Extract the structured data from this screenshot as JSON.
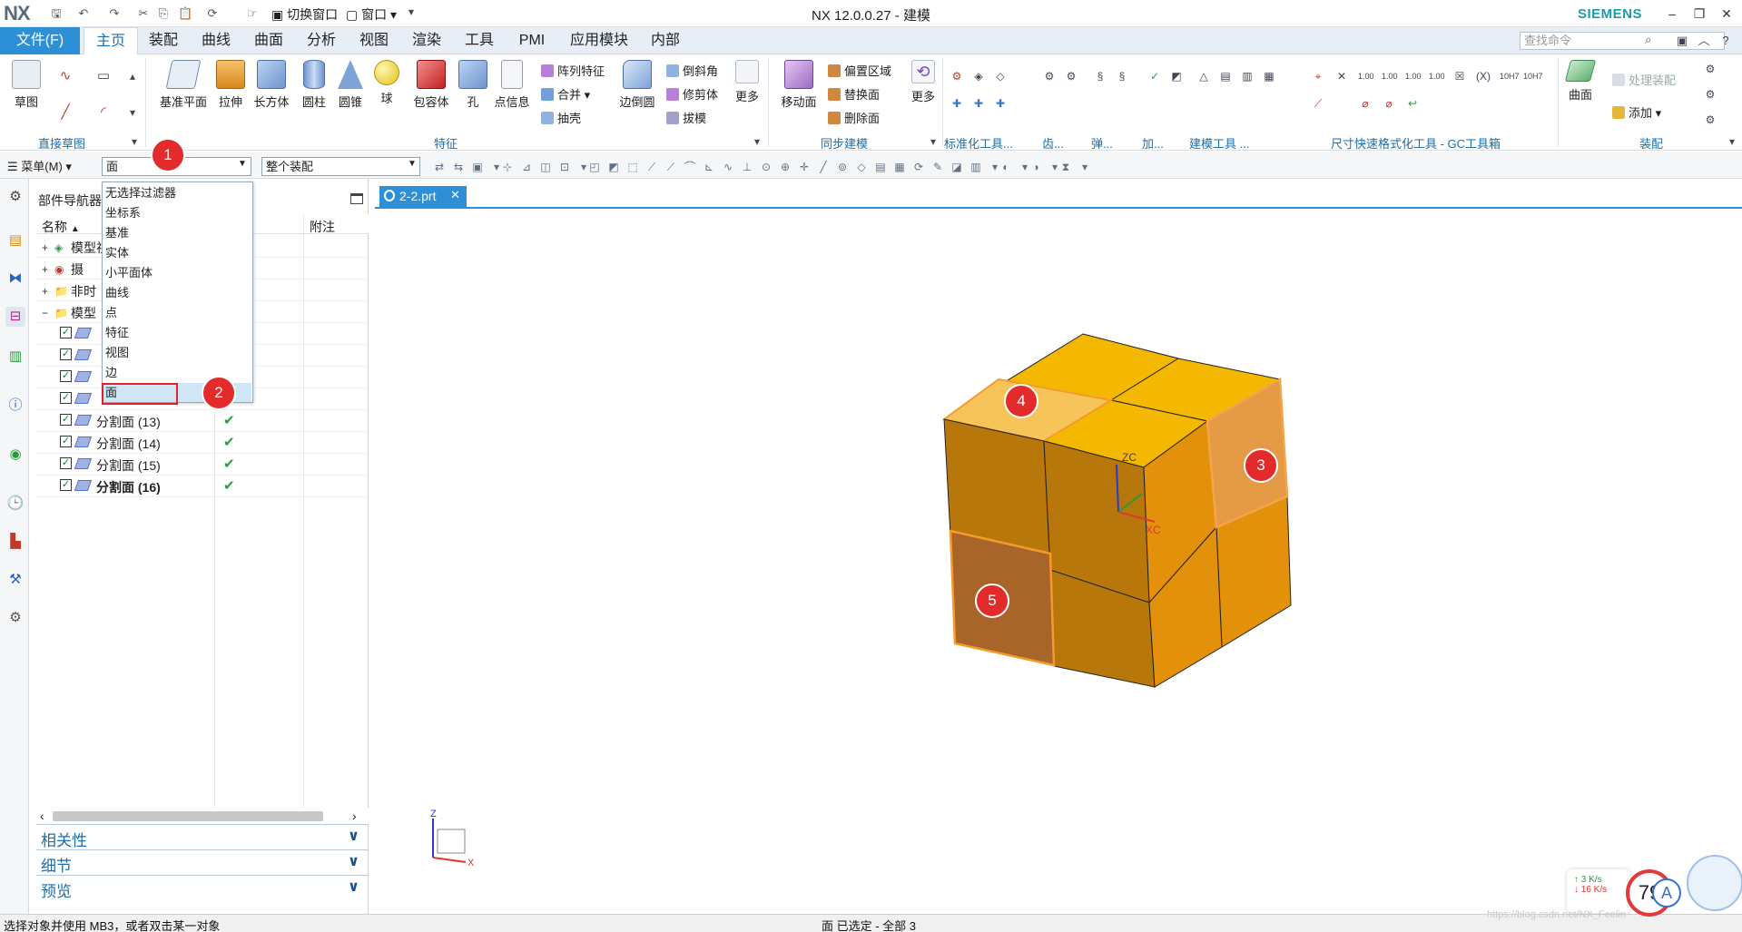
{
  "titlebar": {
    "logo": "NX",
    "title": "NX 12.0.0.27 - 建模",
    "brand": "SIEMENS",
    "switch_window": "切换窗口",
    "window_menu": "窗口",
    "min": "–",
    "restore": "❐",
    "close": "✕"
  },
  "tabs": {
    "file": "文件(F)",
    "items": [
      "主页",
      "装配",
      "曲线",
      "曲面",
      "分析",
      "视图",
      "渲染",
      "工具",
      "PMI",
      "应用模块",
      "内部"
    ],
    "active": "主页",
    "search_placeholder": "查找命令"
  },
  "ribbon": {
    "sketch": "草图",
    "direct_sketch_group": "直接草图",
    "datum_plane": "基准平面",
    "extrude": "拉伸",
    "block": "长方体",
    "cylinder": "圆柱",
    "cone": "圆锥",
    "sphere": "球",
    "bounding_body": "包容体",
    "hole": "孔",
    "point_info": "点信息",
    "pattern_feature": "阵列特征",
    "unite": "合并",
    "shell": "抽壳",
    "edge_blend": "边倒圆",
    "chamfer": "倒斜角",
    "trim_body": "修剪体",
    "draft": "拔模",
    "more1": "更多",
    "feature_group": "特征",
    "move_face": "移动面",
    "offset_region": "偏置区域",
    "replace_face": "替换面",
    "delete_face": "删除面",
    "more2": "更多",
    "sync_group": "同步建模",
    "std_tools": "标准化工具...",
    "gear": "齿...",
    "spring": "弹...",
    "add": "加...",
    "model_tools": "建模工具 ...",
    "dim_tools": "尺寸快速格式化工具 - GC工具箱",
    "surface": "曲面",
    "process_assembly": "处理装配",
    "add_component": "添加",
    "assembly_group": "装配"
  },
  "selection_bar": {
    "menu": "菜单(M)",
    "filter_value": "面",
    "scope_value": "整个装配"
  },
  "filter_dropdown": {
    "options": [
      "无选择过滤器",
      "坐标系",
      "基准",
      "实体",
      "小平面体",
      "曲线",
      "点",
      "特征",
      "视图",
      "边",
      "面"
    ],
    "selected": "面"
  },
  "navigator": {
    "title": "部件导航器",
    "col_name": "名称",
    "col_note": "附注",
    "rows": [
      {
        "label": "模型视",
        "expand": "+",
        "kind": "views"
      },
      {
        "label": "摄",
        "expand": "+",
        "kind": "camera"
      },
      {
        "label": "非时",
        "expand": "+",
        "kind": "folder"
      },
      {
        "label": "模型",
        "expand": "−",
        "kind": "folder"
      },
      {
        "label": "",
        "kind": "feature"
      },
      {
        "label": "",
        "kind": "feature"
      },
      {
        "label": "",
        "kind": "feature"
      },
      {
        "label": "",
        "kind": "feature"
      },
      {
        "label": "分割面 (13)",
        "kind": "face",
        "ok": "✔"
      },
      {
        "label": "分割面 (14)",
        "kind": "face",
        "ok": "✔"
      },
      {
        "label": "分割面 (15)",
        "kind": "face",
        "ok": "✔"
      },
      {
        "label": "分割面 (16)",
        "kind": "face",
        "ok": "✔",
        "bold": true
      }
    ],
    "sections": [
      "相关性",
      "细节",
      "预览"
    ]
  },
  "graphics": {
    "tab_label": "2-2.prt",
    "axis_zc": "ZC",
    "axis_xc": "XC",
    "axis_yc": "YC",
    "tri_z": "Z",
    "tri_x": "X"
  },
  "markers": [
    "1",
    "2",
    "3",
    "4",
    "5"
  ],
  "status": {
    "left": "选择对象并使用 MB3，或者双击某一对象",
    "center": "面 已选定 - 全部 3"
  },
  "net_widget": {
    "up": "3  K/s",
    "down": "16  K/s",
    "badge": "79",
    "watermark": "https://blog.csdn.net/NX_Feelin"
  },
  "colors": {
    "accent_blue": "#2d8fd6",
    "cube_top": "#f5b800",
    "cube_left": "#b8770a",
    "cube_right": "#e3910b",
    "selected_face": "#f5a44a",
    "marker_red": "#e32b2b"
  }
}
